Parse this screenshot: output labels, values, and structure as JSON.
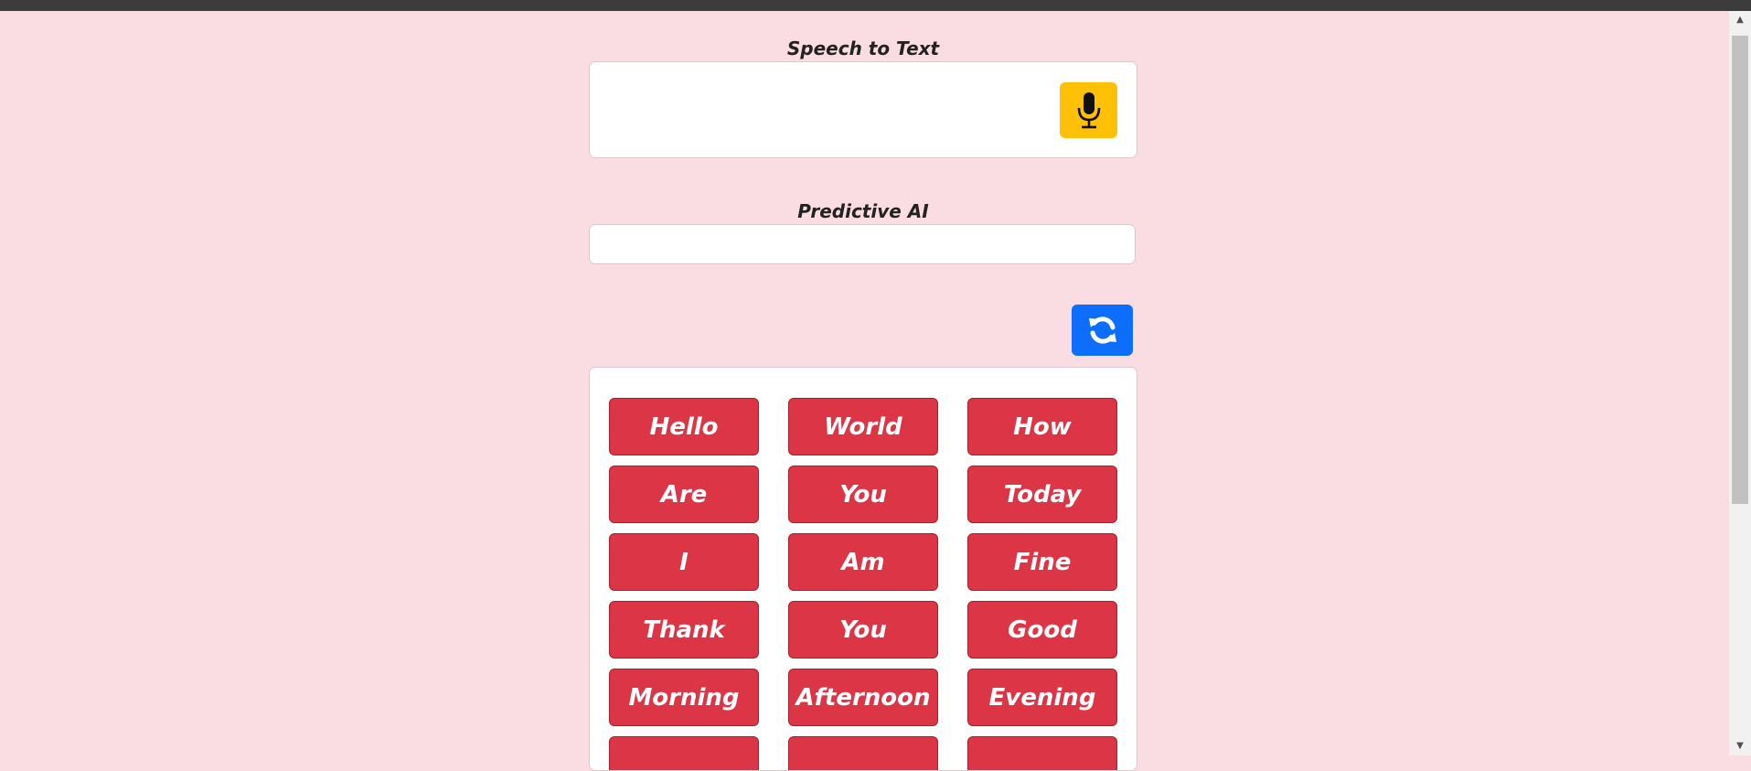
{
  "speech_to_text": {
    "label": "Speech to Text",
    "value": "",
    "mic_icon": "microphone-icon",
    "mic_color": "#ffc107"
  },
  "predictive_ai": {
    "label": "Predictive AI",
    "value": "",
    "refresh_icon": "refresh-icon",
    "refresh_color": "#0d6efd"
  },
  "words": [
    "Hello",
    "World",
    "How",
    "Are",
    "You",
    "Today",
    "I",
    "Am",
    "Fine",
    "Thank",
    "You",
    "Good",
    "Morning",
    "Afternoon",
    "Evening",
    "",
    "",
    ""
  ],
  "colors": {
    "background": "#fadde2",
    "word_button": "#dc3545"
  }
}
